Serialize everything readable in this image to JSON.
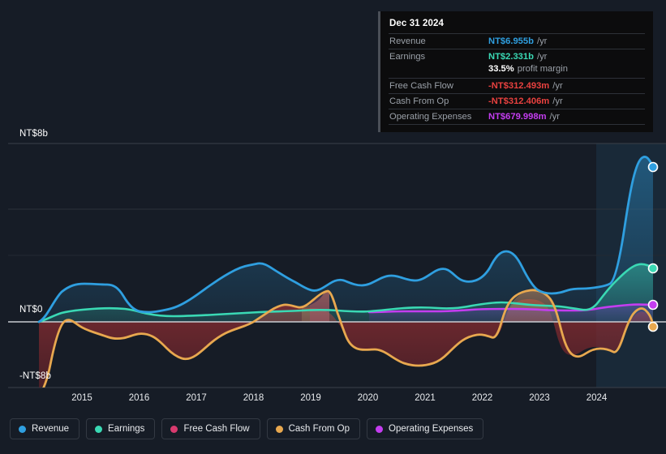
{
  "tooltip": {
    "date": "Dec 31 2024",
    "rows": [
      {
        "label": "Revenue",
        "value": "NT$6.955b",
        "unit": "/yr",
        "color": "#2f9fe0"
      },
      {
        "label": "Earnings",
        "value": "NT$2.331b",
        "unit": "/yr",
        "color": "#3ad9b4"
      },
      {
        "label": "Free Cash Flow",
        "value": "-NT$312.493m",
        "unit": "/yr",
        "color": "#e8413f"
      },
      {
        "label": "Cash From Op",
        "value": "-NT$312.406m",
        "unit": "/yr",
        "color": "#e8413f"
      },
      {
        "label": "Operating Expenses",
        "value": "NT$679.998m",
        "unit": "/yr",
        "color": "#c43df0"
      }
    ],
    "profit_margin_value": "33.5%",
    "profit_margin_label": "profit margin"
  },
  "legend": [
    {
      "label": "Revenue",
      "color": "#2f9fe0"
    },
    {
      "label": "Earnings",
      "color": "#3ad9b4"
    },
    {
      "label": "Free Cash Flow",
      "color": "#d83a6e"
    },
    {
      "label": "Cash From Op",
      "color": "#e8a84f"
    },
    {
      "label": "Operating Expenses",
      "color": "#c43df0"
    }
  ],
  "axis": {
    "y_top_label": "NT$8b",
    "y_zero_label": "NT$0",
    "y_bottom_label": "-NT$8b",
    "x_ticks": [
      "2015",
      "2016",
      "2017",
      "2018",
      "2019",
      "2020",
      "2021",
      "2022",
      "2023",
      "2024"
    ]
  },
  "chart_data": {
    "type": "area",
    "title": "",
    "xlabel": "",
    "ylabel": "NT$",
    "ylim": [
      -8,
      8
    ],
    "ytick_labels": [
      "NT$8b",
      "NT$0",
      "-NT$8b"
    ],
    "ytick_values": [
      8,
      0,
      -8
    ],
    "x": [
      "2015",
      "2016",
      "2017",
      "2018",
      "2019",
      "2020",
      "2021",
      "2022",
      "2023",
      "2024"
    ],
    "grid": true,
    "legend_position": "bottom",
    "currency": "NT$",
    "units": "billions",
    "series": [
      {
        "name": "Revenue",
        "color": "#2f9fe0",
        "values": [
          1.45,
          0.62,
          1.55,
          2.3,
          2.05,
          1.95,
          2.7,
          2.0,
          2.65,
          6.955
        ]
      },
      {
        "name": "Earnings",
        "color": "#3ad9b4",
        "values": [
          0.42,
          0.26,
          0.3,
          0.32,
          0.3,
          0.34,
          0.42,
          0.33,
          0.55,
          2.331
        ]
      },
      {
        "name": "Free Cash Flow",
        "color": "#d83a6e",
        "values": [
          -0.9,
          -2.1,
          0.05,
          0.55,
          -2.0,
          -1.8,
          0.85,
          -1.5,
          1.35,
          -0.312
        ]
      },
      {
        "name": "Cash From Op",
        "color": "#e8a84f",
        "values": [
          -0.9,
          -2.1,
          0.05,
          0.55,
          -2.0,
          -1.8,
          0.85,
          -1.5,
          1.35,
          -0.312
        ]
      },
      {
        "name": "Operating Expenses",
        "color": "#c43df0",
        "values": [
          null,
          null,
          null,
          null,
          null,
          0.28,
          0.3,
          0.3,
          0.45,
          0.68
        ]
      }
    ],
    "endpoints": [
      {
        "name": "Revenue",
        "value": 6.955,
        "color": "#2f9fe0"
      },
      {
        "name": "Earnings",
        "value": 2.331,
        "color": "#3ad9b4"
      },
      {
        "name": "Operating Expenses",
        "value": 0.68,
        "color": "#c43df0"
      },
      {
        "name": "Cash From Op",
        "value": -0.312,
        "color": "#e8a84f"
      }
    ]
  }
}
